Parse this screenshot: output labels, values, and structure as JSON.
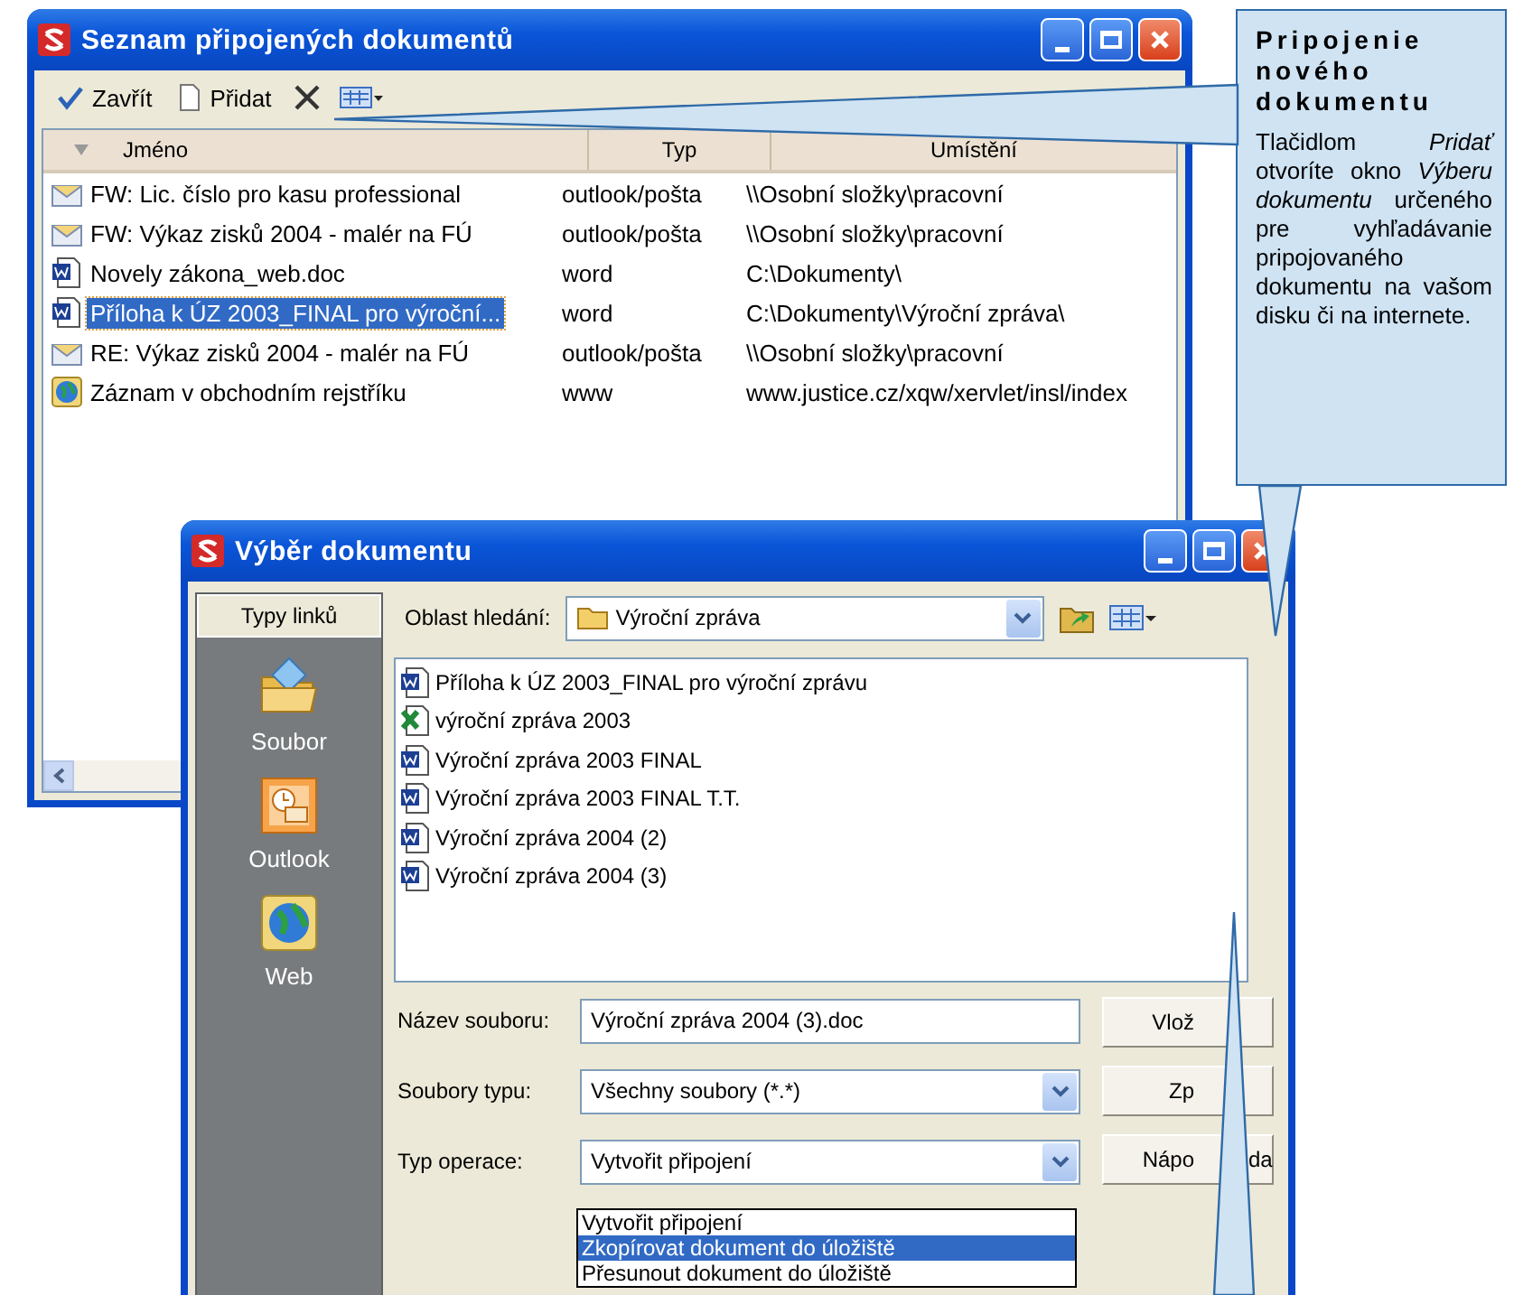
{
  "documents_window": {
    "title": "Seznam připojených dokumentů",
    "toolbar": [
      {
        "kind": "close",
        "label": "Zavřít"
      },
      {
        "kind": "add",
        "label": "Přidat"
      },
      {
        "kind": "delete"
      },
      {
        "kind": "view"
      }
    ],
    "columns": [
      "Jméno",
      "Typ",
      "Umístění"
    ],
    "rows": [
      {
        "kind": "mail",
        "name": "FW: Lic. číslo pro kasu professional",
        "type": "outlook/pošta",
        "location": "\\\\Osobní složky\\pracovní",
        "selected": false
      },
      {
        "kind": "mail",
        "name": "FW: Výkaz zisků 2004 - malér na FÚ",
        "type": "outlook/pošta",
        "location": "\\\\Osobní složky\\pracovní",
        "selected": false
      },
      {
        "kind": "word",
        "name": "Novely zákona_web.doc",
        "type": "word",
        "location": "C:\\Dokumenty\\",
        "selected": false
      },
      {
        "kind": "word",
        "name": "Příloha k ÚZ 2003_FINAL pro výroční...",
        "type": "word",
        "location": "C:\\Dokumenty\\Výroční zpráva\\",
        "selected": true
      },
      {
        "kind": "mail",
        "name": "RE: Výkaz zisků 2004 - malér na FÚ",
        "type": "outlook/pošta",
        "location": "\\\\Osobní složky\\pracovní",
        "selected": false
      },
      {
        "kind": "web",
        "name": "Záznam v obchodním rejstříku",
        "type": "www",
        "location": "www.justice.cz/xqw/xervlet/insl/index",
        "selected": false
      }
    ]
  },
  "callout": {
    "title": "Pripojenie nového dokumentu",
    "text": "Tlačidlom *Pridať* otvoríte okno *Výberu dokumentu* určeného pre vyhľadávanie pripojovaného dokumentu na vašom disku či na internete."
  },
  "picker_window": {
    "title": "Výběr dokumentu",
    "links_heading": "Typy linků",
    "links": [
      {
        "kind": "file",
        "label": "Soubor"
      },
      {
        "kind": "outlook",
        "label": "Outlook"
      },
      {
        "kind": "web",
        "label": "Web"
      }
    ],
    "look_in": {
      "label": "Oblast hledání:",
      "value": "Výroční zpráva"
    },
    "files": [
      {
        "kind": "word",
        "name": "Příloha k ÚZ 2003_FINAL pro výroční zprávu"
      },
      {
        "kind": "excel",
        "name": "výroční zpráva 2003"
      },
      {
        "kind": "word",
        "name": "Výroční zpráva 2003 FINAL"
      },
      {
        "kind": "word",
        "name": "Výroční zpráva 2003 FINAL T.T."
      },
      {
        "kind": "word",
        "name": "Výroční zpráva 2004 (2)"
      },
      {
        "kind": "word",
        "name": "Výroční zpráva 2004 (3)"
      }
    ],
    "fields": [
      {
        "kind": "text",
        "label": "Název souboru:",
        "value": "Výroční zpráva 2004 (3).doc"
      },
      {
        "kind": "combo",
        "label": "Soubory typu:",
        "value": "Všechny soubory (*.*)"
      },
      {
        "kind": "combo",
        "label": "Typ operace:",
        "value": "Vytvořit připojení"
      }
    ],
    "operation_options": [
      {
        "label": "Vytvořit připojení",
        "selected": false
      },
      {
        "label": "Zkopírovat dokument do úložiště",
        "selected": true
      },
      {
        "label": "Přesunout dokument do úložiště",
        "selected": false
      }
    ],
    "buttons": [
      {
        "label": "Vlož"
      },
      {
        "label": "Zp"
      },
      {
        "label": "Nápo",
        "tail": "da"
      }
    ]
  }
}
